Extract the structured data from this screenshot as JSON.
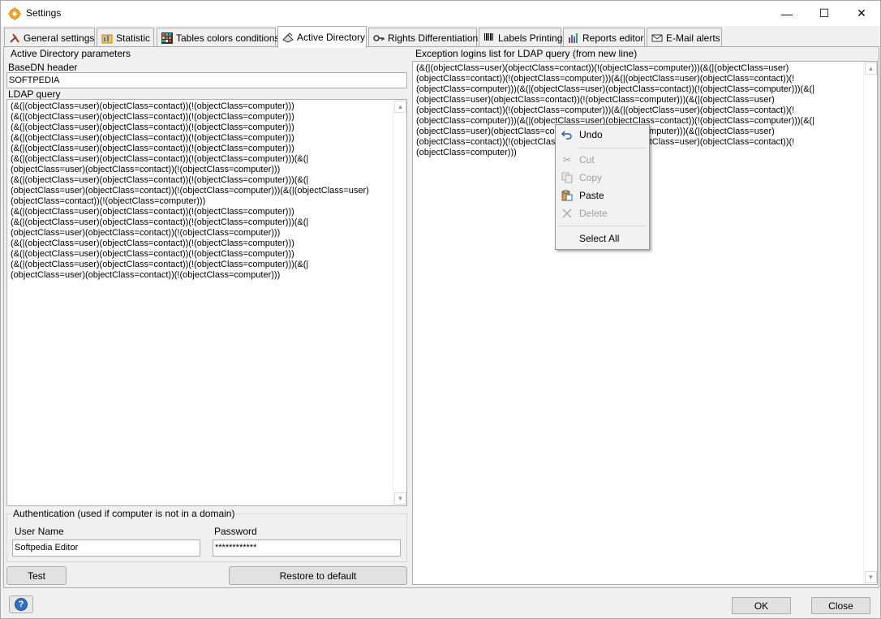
{
  "window": {
    "title": "Settings",
    "minimize": "—",
    "maximize": "☐",
    "close": "✕"
  },
  "tabs": [
    {
      "label": "General settings",
      "icon": "tools-icon"
    },
    {
      "label": "Statistic",
      "icon": "statistic-icon"
    },
    {
      "label": "Tables colors conditions",
      "icon": "color-grid-icon"
    },
    {
      "label": "Active Directory",
      "icon": "directory-icon",
      "active": true
    },
    {
      "label": "Rights Differentiation",
      "icon": "key-icon"
    },
    {
      "label": "Labels Printing",
      "icon": "barcode-icon"
    },
    {
      "label": "Reports editor",
      "icon": "report-chart-icon"
    },
    {
      "label": "E-Mail alerts",
      "icon": "email-icon"
    }
  ],
  "ad": {
    "group_caption": "Active Directory parameters",
    "basedn_label": "BaseDN header",
    "basedn_value": "SOFTPEDIA",
    "ldap_label": "LDAP query",
    "ldap_lines": [
      "(&(|(objectClass=user)(objectClass=contact))(!(objectClass=computer)))",
      "(&(|(objectClass=user)(objectClass=contact))(!(objectClass=computer)))",
      "(&(|(objectClass=user)(objectClass=contact))(!(objectClass=computer)))",
      "(&(|(objectClass=user)(objectClass=contact))(!(objectClass=computer)))",
      "(&(|(objectClass=user)(objectClass=contact))(!(objectClass=computer)))",
      "(&(|(objectClass=user)(objectClass=contact))(!(objectClass=computer)))(&(|",
      "(objectClass=user)(objectClass=contact))(!(objectClass=computer)))",
      "(&(|(objectClass=user)(objectClass=contact))(!(objectClass=computer)))(&(|",
      "(objectClass=user)(objectClass=contact))(!(objectClass=computer)))(&(|(objectClass=user)",
      "(objectClass=contact))(!(objectClass=computer)))",
      "(&(|(objectClass=user)(objectClass=contact))(!(objectClass=computer)))",
      "(&(|(objectClass=user)(objectClass=contact))(!(objectClass=computer)))(&(|",
      "(objectClass=user)(objectClass=contact))(!(objectClass=computer)))",
      "(&(|(objectClass=user)(objectClass=contact))(!(objectClass=computer)))",
      "(&(|(objectClass=user)(objectClass=contact))(!(objectClass=computer)))",
      "(&(|(objectClass=user)(objectClass=contact))(!(objectClass=computer)))(&(|",
      "(objectClass=user)(objectClass=contact))(!(objectClass=computer)))"
    ]
  },
  "auth": {
    "group_caption": "Authentication (used if computer is not in a domain)",
    "username_label": "User Name",
    "username_value": "Softpedia Editor",
    "password_label": "Password",
    "password_value": "************"
  },
  "buttons": {
    "test": "Test",
    "restore": "Restore to default",
    "ok": "OK",
    "close": "Close",
    "help": "?"
  },
  "exceptions": {
    "label": "Exception logins list for LDAP query (from new line)",
    "lines": [
      "(&(|(objectClass=user)(objectClass=contact))(!(objectClass=computer)))(&(|(objectClass=user)",
      "(objectClass=contact))(!(objectClass=computer)))(&(|(objectClass=user)(objectClass=contact))(!",
      "(objectClass=computer)))(&(|(objectClass=user)(objectClass=contact))(!(objectClass=computer)))(&(|",
      "(objectClass=user)(objectClass=contact))(!(objectClass=computer)))(&(|(objectClass=user)",
      "(objectClass=contact))(!(objectClass=computer)))(&(|(objectClass=user)(objectClass=contact))(!",
      "(objectClass=computer)))(&(|(objectClass=user)(objectClass=contact))(!(objectClass=computer)))(&(|",
      "(objectClass=user)(objectClass=contact))(!(objectClass=computer)))(&(|(objectClass=user)",
      "(objectClass=contact))(!(objectClass=computer)))(&(|(objectClass=user)(objectClass=contact))(!",
      "(objectClass=computer)))"
    ]
  },
  "context_menu": {
    "items": [
      {
        "label": "Undo",
        "icon": "undo-icon",
        "enabled": true
      },
      {
        "label": "Cut",
        "icon": "scissors-icon",
        "enabled": false
      },
      {
        "label": "Copy",
        "icon": "copy-icon",
        "enabled": false
      },
      {
        "label": "Paste",
        "icon": "paste-icon",
        "enabled": true
      },
      {
        "label": "Delete",
        "icon": "delete-x-icon",
        "enabled": false
      },
      {
        "label": "Select All",
        "icon": "",
        "enabled": true
      }
    ]
  },
  "colors": {
    "help_blue": "#2f6fc2",
    "disabled_text": "#a0a0a0"
  }
}
